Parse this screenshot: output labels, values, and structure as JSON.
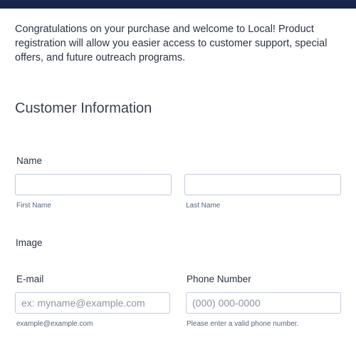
{
  "header": {
    "bar_color": "#16244b"
  },
  "intro": {
    "text": "Congratulations on your purchase and welcome to Local! Product registration will allow you easier access to customer support, special offers, and future outreach programs."
  },
  "section": {
    "title": "Customer Information"
  },
  "name_field": {
    "label": "Name",
    "first_sublabel": "First Name",
    "last_sublabel": "Last Name",
    "first_value": "",
    "last_value": ""
  },
  "image": {
    "alt": "Image",
    "icon": "broken-image-icon"
  },
  "email_field": {
    "label": "E-mail",
    "placeholder": "ex: myname@example.com",
    "sublabel": "example@example.com"
  },
  "phone_field": {
    "label": "Phone Number",
    "placeholder": "(000) 000-0000",
    "sublabel": "Please enter a valid phone number."
  }
}
